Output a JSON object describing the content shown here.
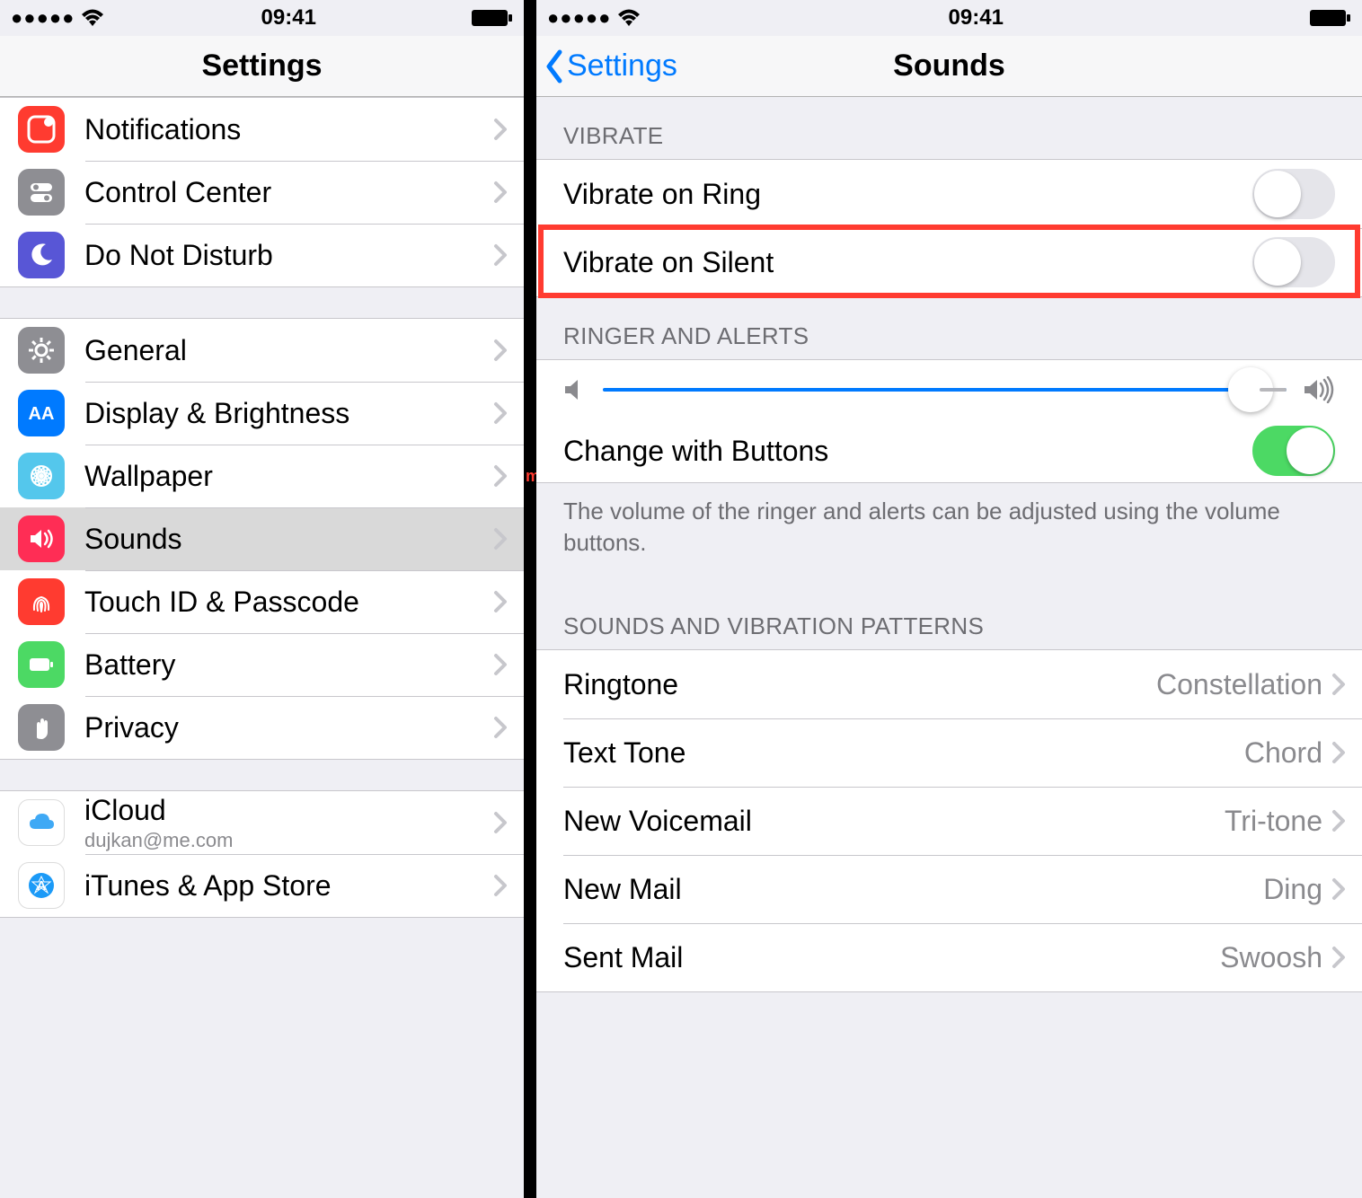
{
  "status": {
    "time": "09:41"
  },
  "left": {
    "title": "Settings",
    "groups": [
      {
        "rows": [
          {
            "key": "notifications",
            "label": "Notifications",
            "icon": "notifications",
            "color": "#ff3b30"
          },
          {
            "key": "control-center",
            "label": "Control Center",
            "icon": "control-center",
            "color": "#8e8e93"
          },
          {
            "key": "dnd",
            "label": "Do Not Disturb",
            "icon": "moon",
            "color": "#5856d6"
          }
        ]
      },
      {
        "rows": [
          {
            "key": "general",
            "label": "General",
            "icon": "gear",
            "color": "#8e8e93"
          },
          {
            "key": "display",
            "label": "Display & Brightness",
            "icon": "display",
            "color": "#007aff"
          },
          {
            "key": "wallpaper",
            "label": "Wallpaper",
            "icon": "wallpaper",
            "color": "#54c7ec"
          },
          {
            "key": "sounds",
            "label": "Sounds",
            "icon": "sounds",
            "color": "#ff2d55",
            "selected": true
          },
          {
            "key": "touchid",
            "label": "Touch ID & Passcode",
            "icon": "touchid",
            "color": "#ff3b30"
          },
          {
            "key": "battery",
            "label": "Battery",
            "icon": "battery",
            "color": "#4cd964"
          },
          {
            "key": "privacy",
            "label": "Privacy",
            "icon": "hand",
            "color": "#8e8e93"
          }
        ]
      },
      {
        "rows": [
          {
            "key": "icloud",
            "label": "iCloud",
            "sub": "dujkan@me.com",
            "icon": "icloud",
            "color": "#ffffff"
          },
          {
            "key": "itunes",
            "label": "iTunes & App Store",
            "icon": "appstore",
            "color": "#ffffff"
          }
        ]
      }
    ]
  },
  "right": {
    "back": "Settings",
    "title": "Sounds",
    "sections": {
      "vibrate": {
        "header": "VIBRATE",
        "rows": [
          {
            "key": "vibrate-ring",
            "label": "Vibrate on Ring",
            "toggle": false
          },
          {
            "key": "vibrate-silent",
            "label": "Vibrate on Silent",
            "toggle": false,
            "highlight": true
          }
        ]
      },
      "ringer": {
        "header": "RINGER AND ALERTS",
        "change_label": "Change with Buttons",
        "change_toggle": true,
        "footer": "The volume of the ringer and alerts can be adjusted using the volume buttons."
      },
      "patterns": {
        "header": "SOUNDS AND VIBRATION PATTERNS",
        "rows": [
          {
            "key": "ringtone",
            "label": "Ringtone",
            "value": "Constellation"
          },
          {
            "key": "texttone",
            "label": "Text Tone",
            "value": "Chord"
          },
          {
            "key": "voicemail",
            "label": "New Voicemail",
            "value": "Tri-tone"
          },
          {
            "key": "newmail",
            "label": "New Mail",
            "value": "Ding"
          },
          {
            "key": "sentmail",
            "label": "Sent Mail",
            "value": "Swoosh"
          }
        ]
      }
    }
  }
}
